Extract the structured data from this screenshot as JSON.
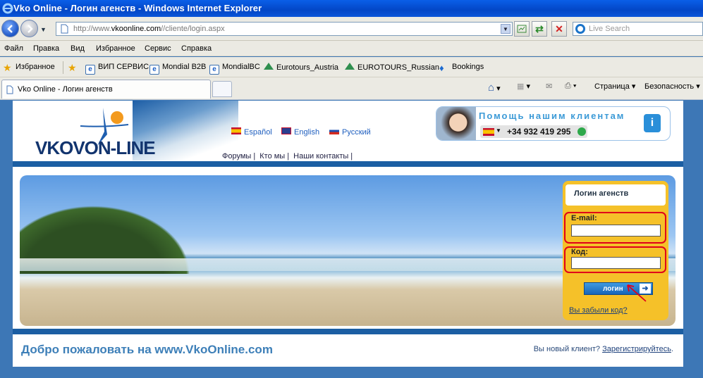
{
  "window": {
    "title": "Vko Online - Логин агенств - Windows Internet Explorer"
  },
  "address": {
    "url_prefix": "http://www.",
    "url_host": "vkoonline.com",
    "url_path": "//cliente/login.aspx",
    "search_placeholder": "Live Search"
  },
  "menu": [
    "Файл",
    "Правка",
    "Вид",
    "Избранное",
    "Сервис",
    "Справка"
  ],
  "favorites": {
    "label": "Избранное",
    "items": [
      "ВИП СЕРВИС",
      "Mondial B2B",
      "MondialBC",
      "Eurotours_Austria",
      "EUROTOURS_Russian",
      "Bookings"
    ]
  },
  "tabs": {
    "active": "Vko Online - Логин агенств"
  },
  "command_bar": {
    "page": "Страница",
    "safety": "Безопасность"
  },
  "site": {
    "logo_text": "VKOVON-LINE",
    "languages": [
      "Español",
      "English",
      "Русский"
    ],
    "top_links": [
      "Форумы",
      "Кто мы",
      "Наши контакты"
    ],
    "help_title": "Помощь нашим клиентам",
    "phone": "+34 932 419 295",
    "info_glyph": "i"
  },
  "login": {
    "title": "Логин агенств",
    "email_label": "E-mail:",
    "email_value": "",
    "code_label": "Код:",
    "code_value": "",
    "button_label": "логин",
    "forgot": "Вы забыли код?"
  },
  "footer": {
    "welcome": "Добро пожаловать на www.VkoOnline.com",
    "new_client_text": "Вы новый клиент?",
    "register": "Зарегистрируйтесь",
    "period": "."
  },
  "colors": {
    "brand_blue": "#1b5ea3",
    "panel_yellow": "#f5c129",
    "highlight_red": "#e0001a"
  }
}
